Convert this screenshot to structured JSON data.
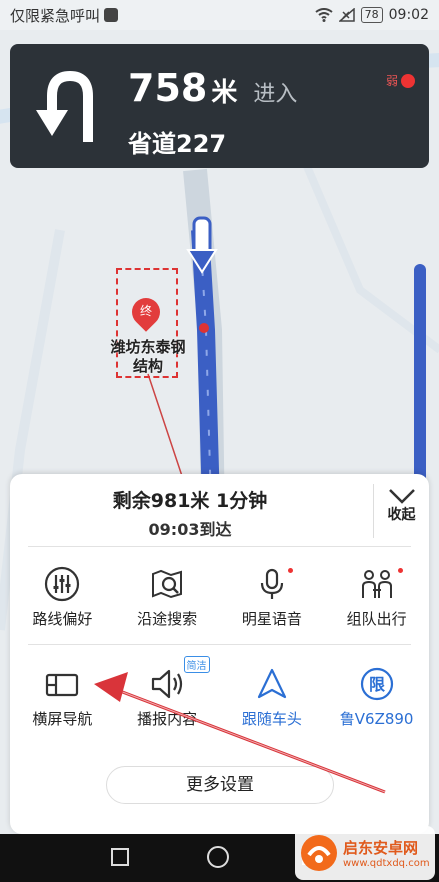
{
  "status_bar": {
    "left_text": "仅限紧急呼叫",
    "battery": "78",
    "time": "09:02"
  },
  "nav_panel": {
    "distance_value": "758",
    "distance_unit": "米",
    "action": "进入",
    "road_name": "省道227",
    "signal_text": "弱"
  },
  "destination": {
    "pin_text": "终",
    "label": "潍坊东泰钢结构"
  },
  "summary": {
    "remaining": "剩余981米 1分钟",
    "arrival": "09:03到达",
    "collapse_label": "收起"
  },
  "options_row1": [
    {
      "label": "路线偏好",
      "icon": "sliders-icon"
    },
    {
      "label": "沿途搜索",
      "icon": "map-search-icon"
    },
    {
      "label": "明星语音",
      "icon": "microphone-icon"
    },
    {
      "label": "组队出行",
      "icon": "team-icon"
    }
  ],
  "options_row2": [
    {
      "label": "横屏导航",
      "icon": "landscape-icon"
    },
    {
      "label": "播报内容",
      "icon": "speaker-icon",
      "badge": "简洁"
    },
    {
      "label": "跟随车头",
      "icon": "heading-arrow-icon"
    },
    {
      "label": "鲁V6Z890",
      "icon": "restriction-icon",
      "icon_text": "限"
    }
  ],
  "more_settings": "更多设置",
  "watermark": {
    "title": "启东安卓网",
    "url": "www.qdtxdq.com"
  },
  "colors": {
    "accent": "#2b6fd4",
    "panel": "#2c3238",
    "route": "#3b5fc4",
    "arrow": "#d9343a"
  }
}
